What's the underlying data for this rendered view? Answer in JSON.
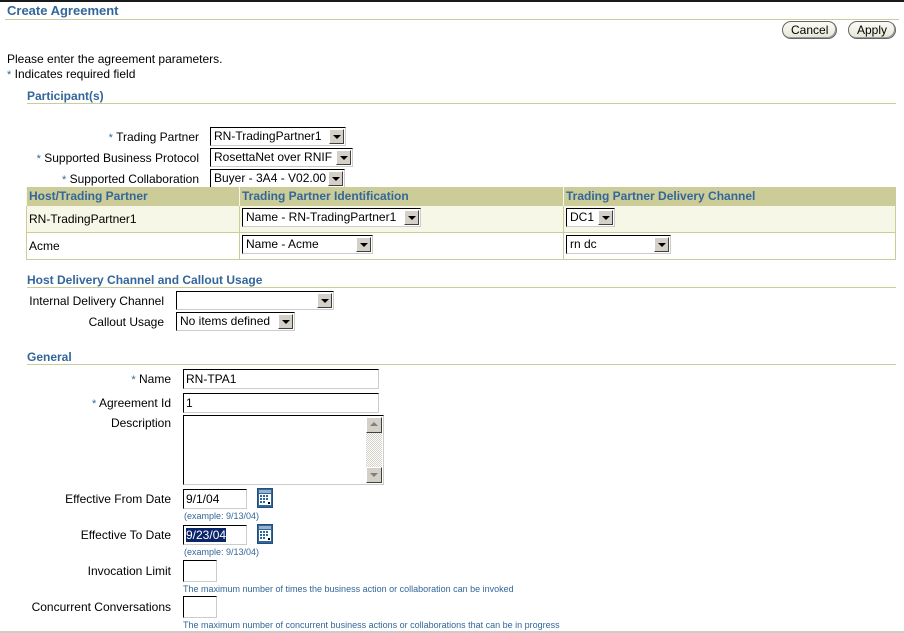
{
  "page": {
    "title": "Create Agreement",
    "intro": "Please enter the agreement parameters.",
    "required_note": "Indicates required field",
    "required_marker": "*"
  },
  "actions": {
    "cancel_label": "Cancel",
    "apply_label": "Apply"
  },
  "participants": {
    "section_title": "Participant(s)",
    "trading_partner": {
      "label": "Trading Partner",
      "value": "RN-TradingPartner1",
      "required": true
    },
    "business_protocol": {
      "label": "Supported Business Protocol",
      "value": "RosettaNet over RNIF",
      "required": true
    },
    "collaboration": {
      "label": "Supported Collaboration",
      "value": "Buyer - 3A4 - V02.00",
      "required": true
    },
    "table": {
      "headers": [
        "Host/Trading Partner",
        "Trading Partner Identification",
        "Trading Partner Delivery Channel"
      ],
      "rows": [
        {
          "partner": "RN-TradingPartner1",
          "identification": "Name - RN-TradingPartner1",
          "delivery_channel": "DC1"
        },
        {
          "partner": "Acme",
          "identification": "Name - Acme",
          "delivery_channel": "rn dc"
        }
      ]
    }
  },
  "host_delivery": {
    "section_title": "Host Delivery Channel and Callout Usage",
    "internal_delivery_channel": {
      "label": "Internal Delivery Channel",
      "value": ""
    },
    "callout_usage": {
      "label": "Callout Usage",
      "value": "No items defined"
    }
  },
  "general": {
    "section_title": "General",
    "name": {
      "label": "Name",
      "value": "RN-TPA1",
      "required": true
    },
    "agreement_id": {
      "label": "Agreement Id",
      "value": "1",
      "required": true
    },
    "description": {
      "label": "Description",
      "value": ""
    },
    "effective_from": {
      "label": "Effective From Date",
      "value": "9/1/04",
      "hint": "(example: 9/13/04)"
    },
    "effective_to": {
      "label": "Effective To Date",
      "value": "9/23/04",
      "hint": "(example: 9/13/04)"
    },
    "invocation_limit": {
      "label": "Invocation Limit",
      "value": "",
      "hint": "The maximum number of times the business action or collaboration can be invoked"
    },
    "concurrent_conversations": {
      "label": "Concurrent Conversations",
      "value": "",
      "hint": "The maximum number of concurrent business actions or collaborations that can be in progress"
    }
  },
  "colors": {
    "accent": "#336699",
    "header_band": "#cccc99",
    "row_alt": "#f7f7e7",
    "selection": "#0a246a"
  }
}
